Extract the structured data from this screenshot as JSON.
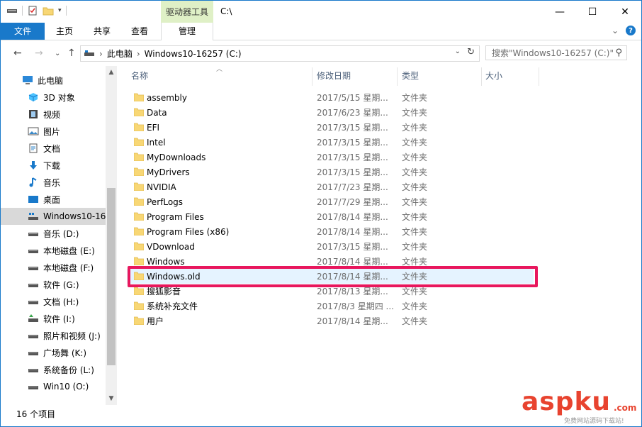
{
  "window": {
    "title": "C:\\",
    "context_tab_title": "驱动器工具",
    "caption": {
      "minimize": "—",
      "maximize": "☐",
      "close": "✕"
    }
  },
  "ribbon": {
    "tabs": [
      "文件",
      "主页",
      "共享",
      "查看",
      "管理"
    ],
    "expand_glyph": "⌄",
    "help_glyph": "?"
  },
  "address": {
    "crumbs": [
      "此电脑",
      "Windows10-16257 (C:)"
    ],
    "separator": "›",
    "search_placeholder": "搜索\"Windows10-16257 (C:)\"",
    "back": "←",
    "forward": "→",
    "recent": "⌄",
    "up": "↑"
  },
  "nav_pane": {
    "items": [
      {
        "label": "此电脑",
        "icon": "computer-icon"
      },
      {
        "label": "3D 对象",
        "icon": "3d-objects-icon"
      },
      {
        "label": "视频",
        "icon": "video-icon"
      },
      {
        "label": "图片",
        "icon": "pictures-icon"
      },
      {
        "label": "文档",
        "icon": "documents-icon"
      },
      {
        "label": "下载",
        "icon": "download-icon"
      },
      {
        "label": "音乐",
        "icon": "music-icon"
      },
      {
        "label": "桌面",
        "icon": "desktop-icon"
      },
      {
        "label": "Windows10-16",
        "icon": "windows-drive-icon",
        "selected": true
      },
      {
        "label": "音乐 (D:)",
        "icon": "drive-icon"
      },
      {
        "label": "本地磁盘 (E:)",
        "icon": "drive-icon"
      },
      {
        "label": "本地磁盘 (F:)",
        "icon": "drive-icon"
      },
      {
        "label": "软件 (G:)",
        "icon": "drive-icon"
      },
      {
        "label": "文档 (H:)",
        "icon": "drive-icon"
      },
      {
        "label": "软件  (I:)",
        "icon": "recycle-drive-icon"
      },
      {
        "label": "照片和视频 (J:)",
        "icon": "drive-icon"
      },
      {
        "label": "广场舞 (K:)",
        "icon": "drive-icon"
      },
      {
        "label": "系统备份 (L:)",
        "icon": "drive-icon"
      },
      {
        "label": "Win10 (O:)",
        "icon": "drive-icon"
      }
    ]
  },
  "columns": {
    "name": "名称",
    "date": "修改日期",
    "type": "类型",
    "size": "大小"
  },
  "files": [
    {
      "name": "assembly",
      "date": "2017/5/15 星期...",
      "type": "文件夹"
    },
    {
      "name": "Data",
      "date": "2017/6/23 星期...",
      "type": "文件夹"
    },
    {
      "name": "EFI",
      "date": "2017/3/15 星期...",
      "type": "文件夹"
    },
    {
      "name": "Intel",
      "date": "2017/3/15 星期...",
      "type": "文件夹"
    },
    {
      "name": "MyDownloads",
      "date": "2017/3/15 星期...",
      "type": "文件夹"
    },
    {
      "name": "MyDrivers",
      "date": "2017/3/15 星期...",
      "type": "文件夹"
    },
    {
      "name": "NVIDIA",
      "date": "2017/7/23 星期...",
      "type": "文件夹"
    },
    {
      "name": "PerfLogs",
      "date": "2017/7/29 星期...",
      "type": "文件夹"
    },
    {
      "name": "Program Files",
      "date": "2017/8/14 星期...",
      "type": "文件夹"
    },
    {
      "name": "Program Files (x86)",
      "date": "2017/8/14 星期...",
      "type": "文件夹"
    },
    {
      "name": "VDownload",
      "date": "2017/3/15 星期...",
      "type": "文件夹"
    },
    {
      "name": "Windows",
      "date": "2017/8/14 星期...",
      "type": "文件夹"
    },
    {
      "name": "Windows.old",
      "date": "2017/8/14 星期...",
      "type": "文件夹",
      "highlighted": true
    },
    {
      "name": "搜狐影音",
      "date": "2017/8/13 星期...",
      "type": "文件夹"
    },
    {
      "name": "系统补充文件",
      "date": "2017/8/3 星期四 ...",
      "type": "文件夹"
    },
    {
      "name": "用户",
      "date": "2017/8/14 星期...",
      "type": "文件夹"
    }
  ],
  "status": {
    "item_count": "16 个项目"
  },
  "watermark": {
    "main": "aspku",
    "tld": ".com",
    "sub": "免费网站源码下载站!"
  },
  "colors": {
    "accent": "#1979ca",
    "highlight_box": "#e8175d",
    "folder": "#f8d775",
    "context_tab": "#dff0c6"
  }
}
